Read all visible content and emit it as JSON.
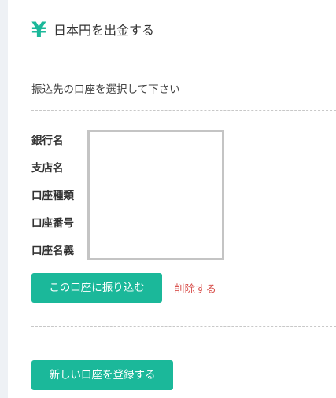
{
  "header": {
    "icon": "yen-icon",
    "icon_glyph": "¥",
    "title": "日本円を出金する",
    "accent_color": "#1bb89a"
  },
  "instruction": "振込先の口座を選択して下さい",
  "account_fields": {
    "bank_name_label": "銀行名",
    "branch_name_label": "支店名",
    "account_type_label": "口座種類",
    "account_number_label": "口座番号",
    "account_holder_label": "口座名義"
  },
  "actions": {
    "transfer_button": "この口座に振り込む",
    "delete_link": "削除する",
    "register_new_button": "新しい口座を登録する",
    "delete_color": "#d9534f"
  }
}
